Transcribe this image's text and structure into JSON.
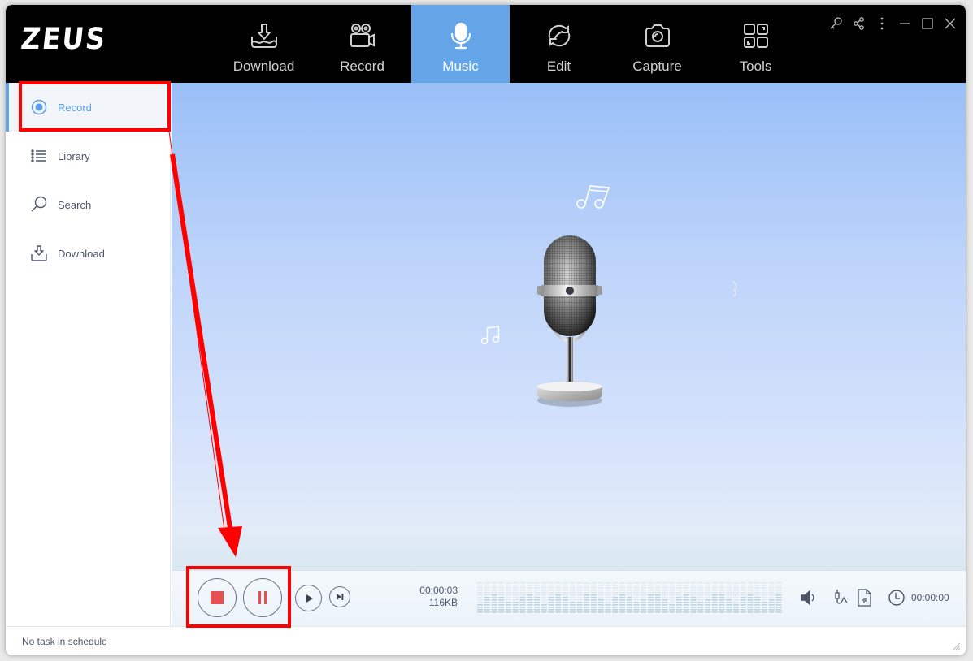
{
  "app": {
    "logo": "ZEUS"
  },
  "nav": {
    "tabs": [
      {
        "label": "Download",
        "icon": "download-tray-icon",
        "active": false
      },
      {
        "label": "Record",
        "icon": "video-camera-icon",
        "active": false
      },
      {
        "label": "Music",
        "icon": "microphone-icon",
        "active": true
      },
      {
        "label": "Edit",
        "icon": "refresh-cycle-icon",
        "active": false
      },
      {
        "label": "Capture",
        "icon": "camera-icon",
        "active": false
      },
      {
        "label": "Tools",
        "icon": "grid-tools-icon",
        "active": false
      }
    ]
  },
  "window_controls": [
    "key-icon",
    "share-icon",
    "more-icon",
    "minimize-icon",
    "maximize-icon",
    "close-icon"
  ],
  "sidebar": {
    "items": [
      {
        "label": "Record",
        "icon": "radio-record-icon",
        "active": true
      },
      {
        "label": "Library",
        "icon": "list-icon",
        "active": false
      },
      {
        "label": "Search",
        "icon": "search-icon",
        "active": false
      },
      {
        "label": "Download",
        "icon": "download-tray-icon",
        "active": false
      }
    ]
  },
  "player": {
    "elapsed": "00:00:03",
    "size": "116KB",
    "schedule_time": "00:00:00",
    "colors": {
      "stop": "#e55050",
      "pause": "#e55050",
      "outline": "#6a7280"
    }
  },
  "status": {
    "text": "No task in schedule"
  },
  "colors": {
    "accent": "#64a5e8",
    "annotation": "#ff0000",
    "topbar": "#000000"
  }
}
